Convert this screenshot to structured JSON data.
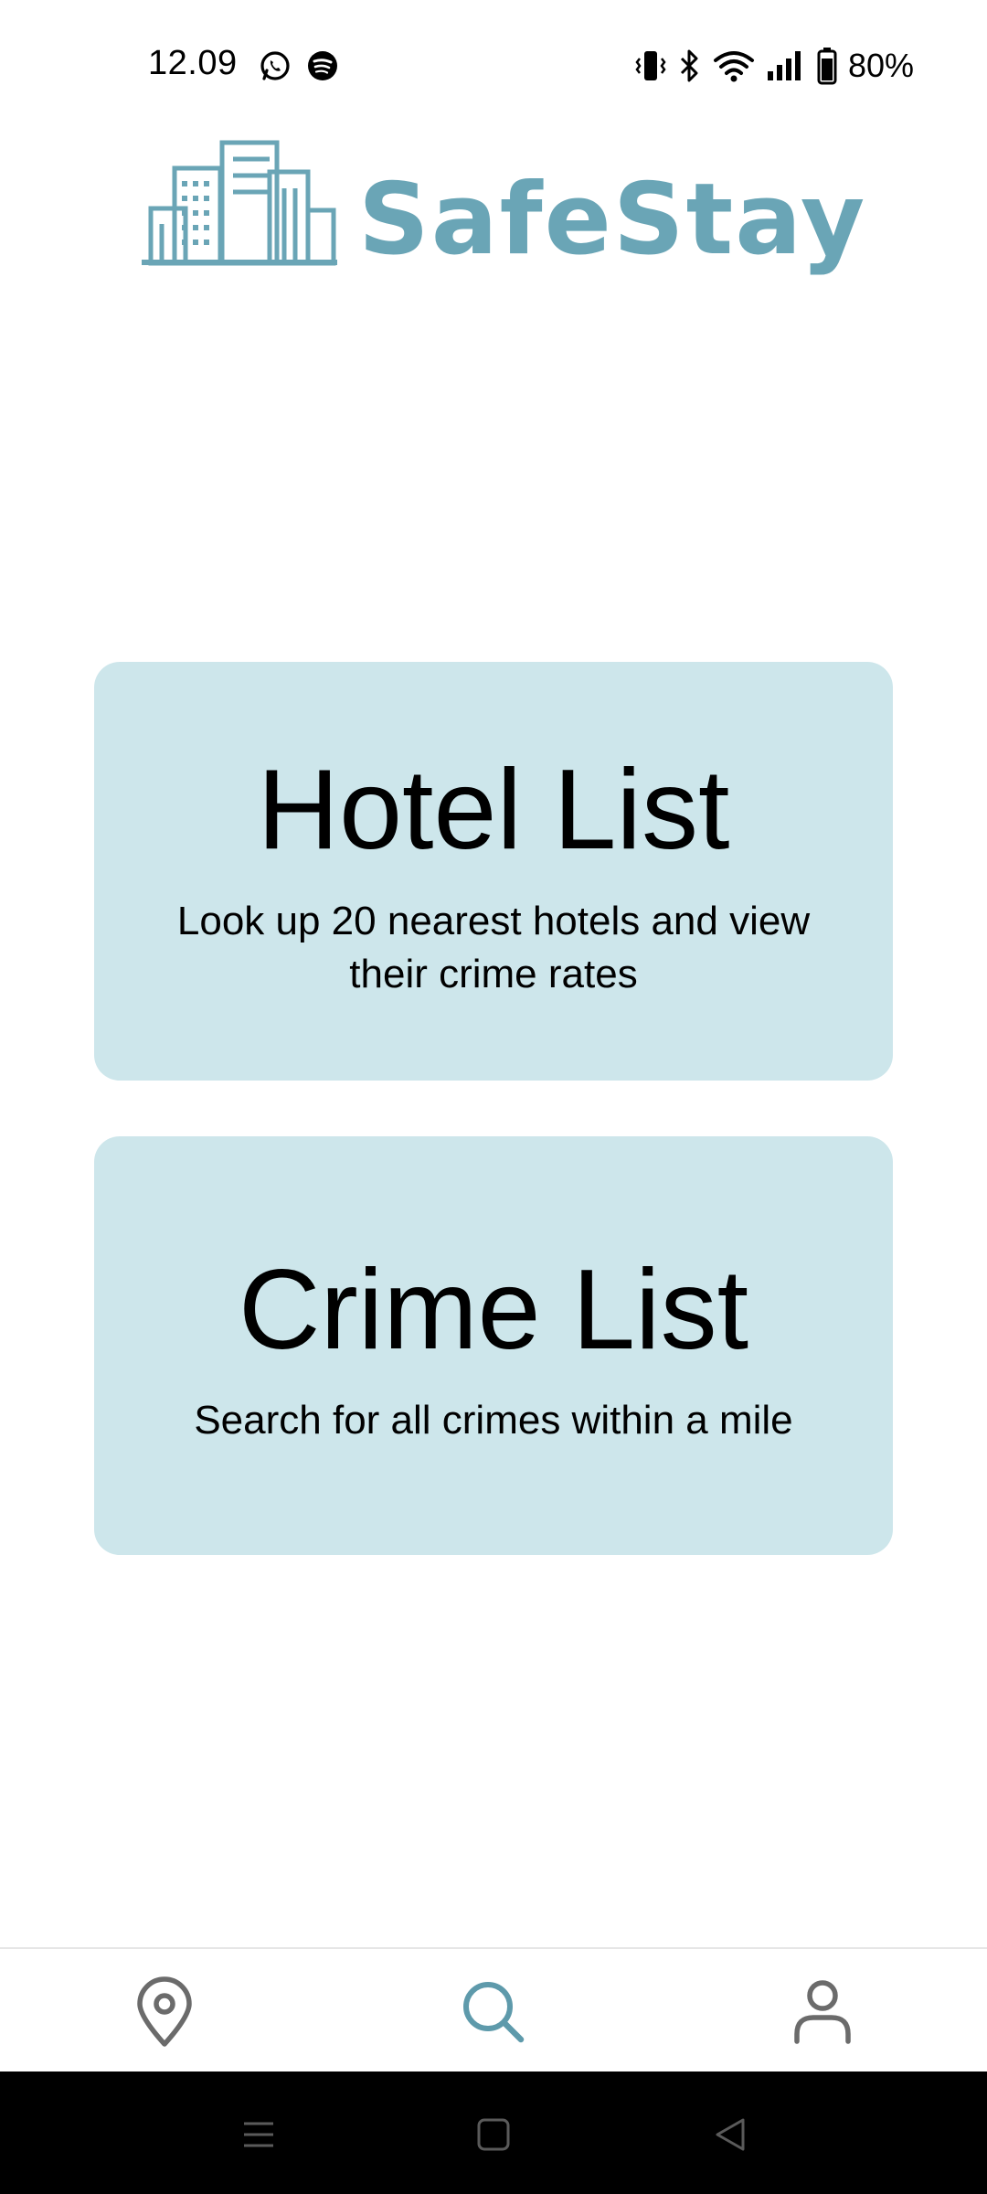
{
  "status_bar": {
    "time": "12.09",
    "left_icons": [
      "whatsapp-icon",
      "spotify-icon"
    ],
    "right_icons": [
      "vibrate-icon",
      "bluetooth-icon",
      "wifi-icon",
      "signal-icon",
      "battery-icon"
    ],
    "battery": "80%"
  },
  "header": {
    "logo_text": "SafeStay",
    "brand_color": "#6aa5b6"
  },
  "cards": [
    {
      "title": "Hotel List",
      "description": "Look up 20 nearest hotels and view their crime rates"
    },
    {
      "title": "Crime List",
      "description": "Search for all crimes within a mile"
    }
  ],
  "card_background": "#cde6eb",
  "bottom_nav": {
    "items": [
      {
        "icon": "map-pin-icon",
        "active": false
      },
      {
        "icon": "search-icon",
        "active": true
      },
      {
        "icon": "profile-icon",
        "active": false
      }
    ],
    "active_color": "#5e9aab",
    "inactive_color": "#6b6b6b"
  },
  "system_nav": {
    "buttons": [
      "menu-icon",
      "home-icon",
      "back-icon"
    ]
  }
}
